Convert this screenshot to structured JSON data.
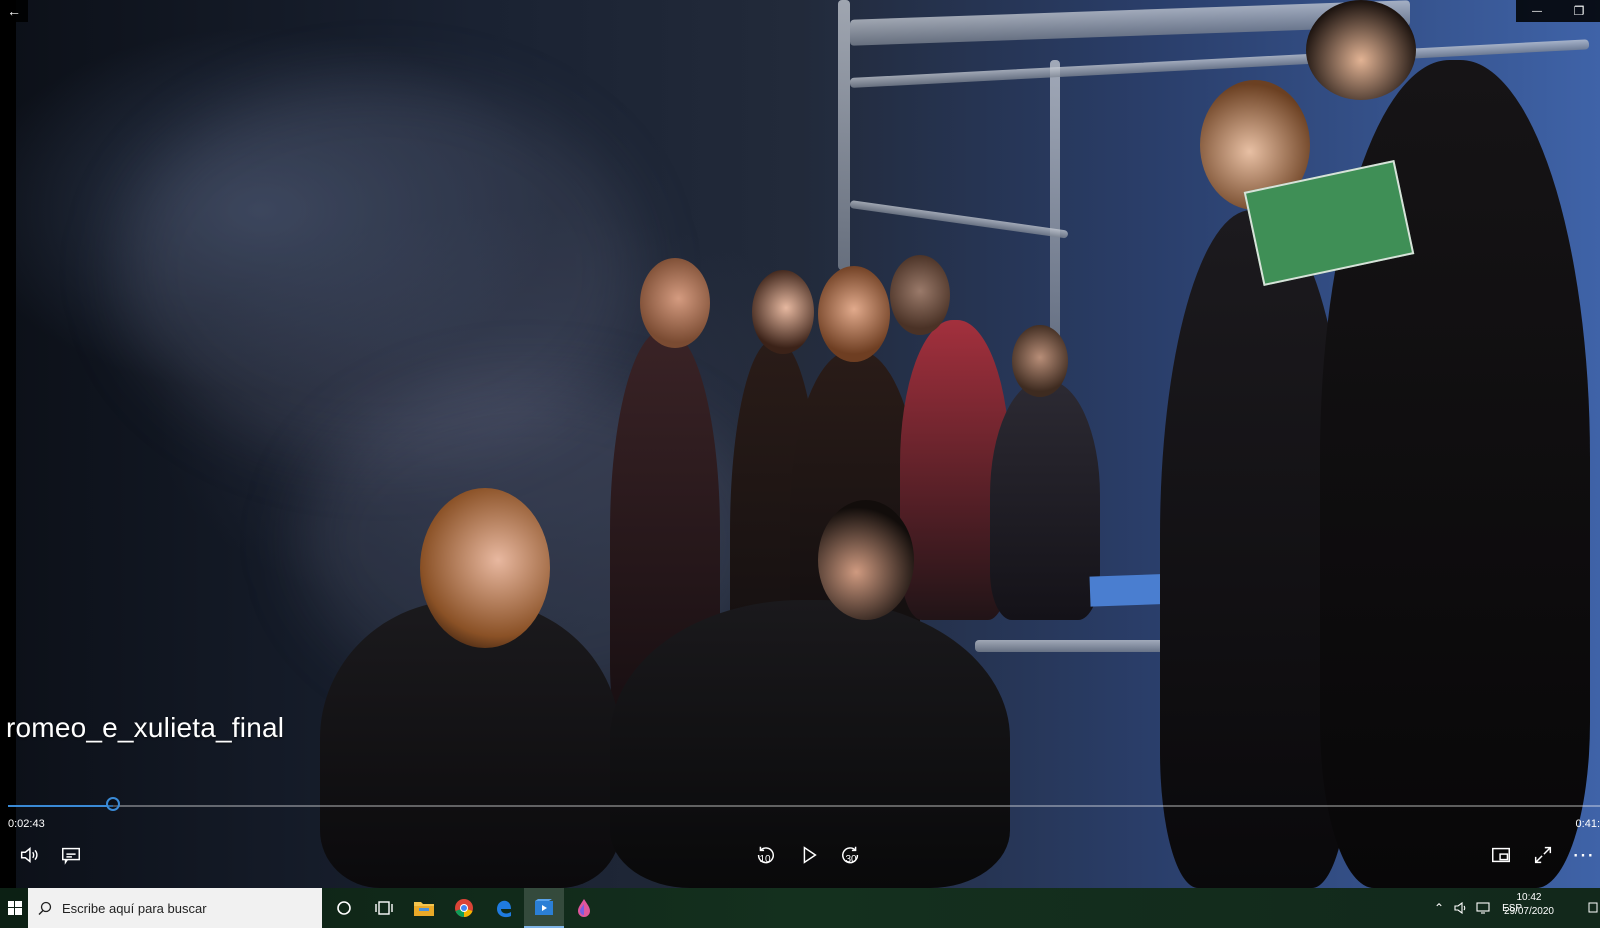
{
  "window": {
    "back_glyph": "←",
    "minimize_glyph": "—",
    "restore_glyph": "❐"
  },
  "player": {
    "title": "romeo_e_xulieta_final",
    "elapsed": "0:02:43",
    "remaining": "0:41:",
    "progress_fraction": 0.066,
    "skip_back_seconds": "10",
    "skip_forward_seconds": "30",
    "accent_color": "#3a8ad6",
    "controls": [
      "volume-icon",
      "subtitles-icon",
      "skip-back-icon",
      "play-icon",
      "skip-forward-icon",
      "mini-view-icon",
      "fullscreen-icon",
      "more-icon"
    ],
    "more_glyph": "⋯"
  },
  "taskbar": {
    "search_placeholder": "Escribe aquí para buscar",
    "apps": [
      "cortana-icon",
      "task-view-icon",
      "file-explorer-icon",
      "chrome-icon",
      "edge-icon",
      "movies-tv-icon",
      "paint-3d-icon"
    ],
    "language": "ESP",
    "time": "10:42",
    "date": "29/07/2020"
  }
}
